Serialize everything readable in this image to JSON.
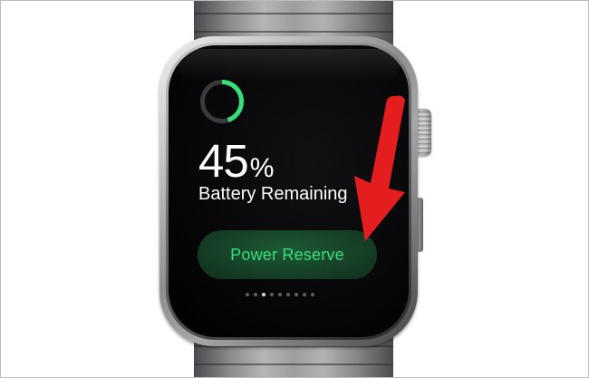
{
  "battery": {
    "percent_value": "45",
    "percent_sign": "%",
    "level_fraction": 0.45,
    "label": "Battery Remaining"
  },
  "power_reserve": {
    "label": "Power Reserve"
  },
  "page_indicator": {
    "total": 9,
    "current": 3
  },
  "colors": {
    "accent_green": "#35e07a",
    "ring_track": "#3a3a3c",
    "button_bg": "#163f27",
    "arrow_red": "#e41e1e",
    "screen_bg": "#000000"
  },
  "icons": {
    "battery_ring": "battery-ring-icon",
    "annotation": "red-arrow-icon"
  }
}
